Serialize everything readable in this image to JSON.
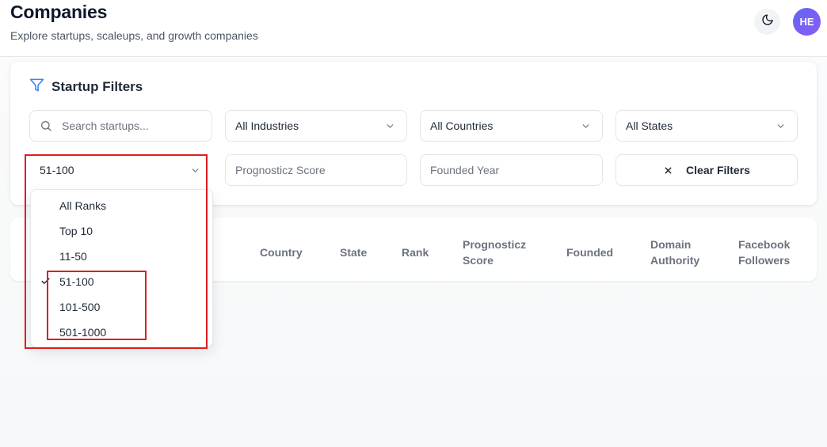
{
  "header": {
    "title": "Companies",
    "subtitle": "Explore startups, scaleups, and growth companies",
    "avatar_initials": "HE"
  },
  "filters": {
    "title": "Startup Filters",
    "search_placeholder": "Search startups...",
    "industry_value": "All Industries",
    "country_value": "All Countries",
    "state_value": "All States",
    "rank_value": "51-100",
    "score_placeholder": "Prognosticz Score",
    "founded_placeholder": "Founded Year",
    "clear_label": "Clear Filters"
  },
  "table": {
    "headers": {
      "country": "Country",
      "state": "State",
      "rank": "Rank",
      "score_line1": "Prognosticz",
      "score_line2": "Score",
      "founded": "Founded",
      "domain_line1": "Domain",
      "domain_line2": "Authority",
      "facebook_line1": "Facebook",
      "facebook_line2": "Followers"
    }
  },
  "rank_dropdown": {
    "options": [
      "All Ranks",
      "Top 10",
      "11-50",
      "51-100",
      "101-500",
      "501-1000"
    ],
    "selected": "51-100"
  },
  "colors": {
    "accent": "#6366f1",
    "filter_icon": "#3b82f6",
    "annotation": "#e11d1d"
  }
}
